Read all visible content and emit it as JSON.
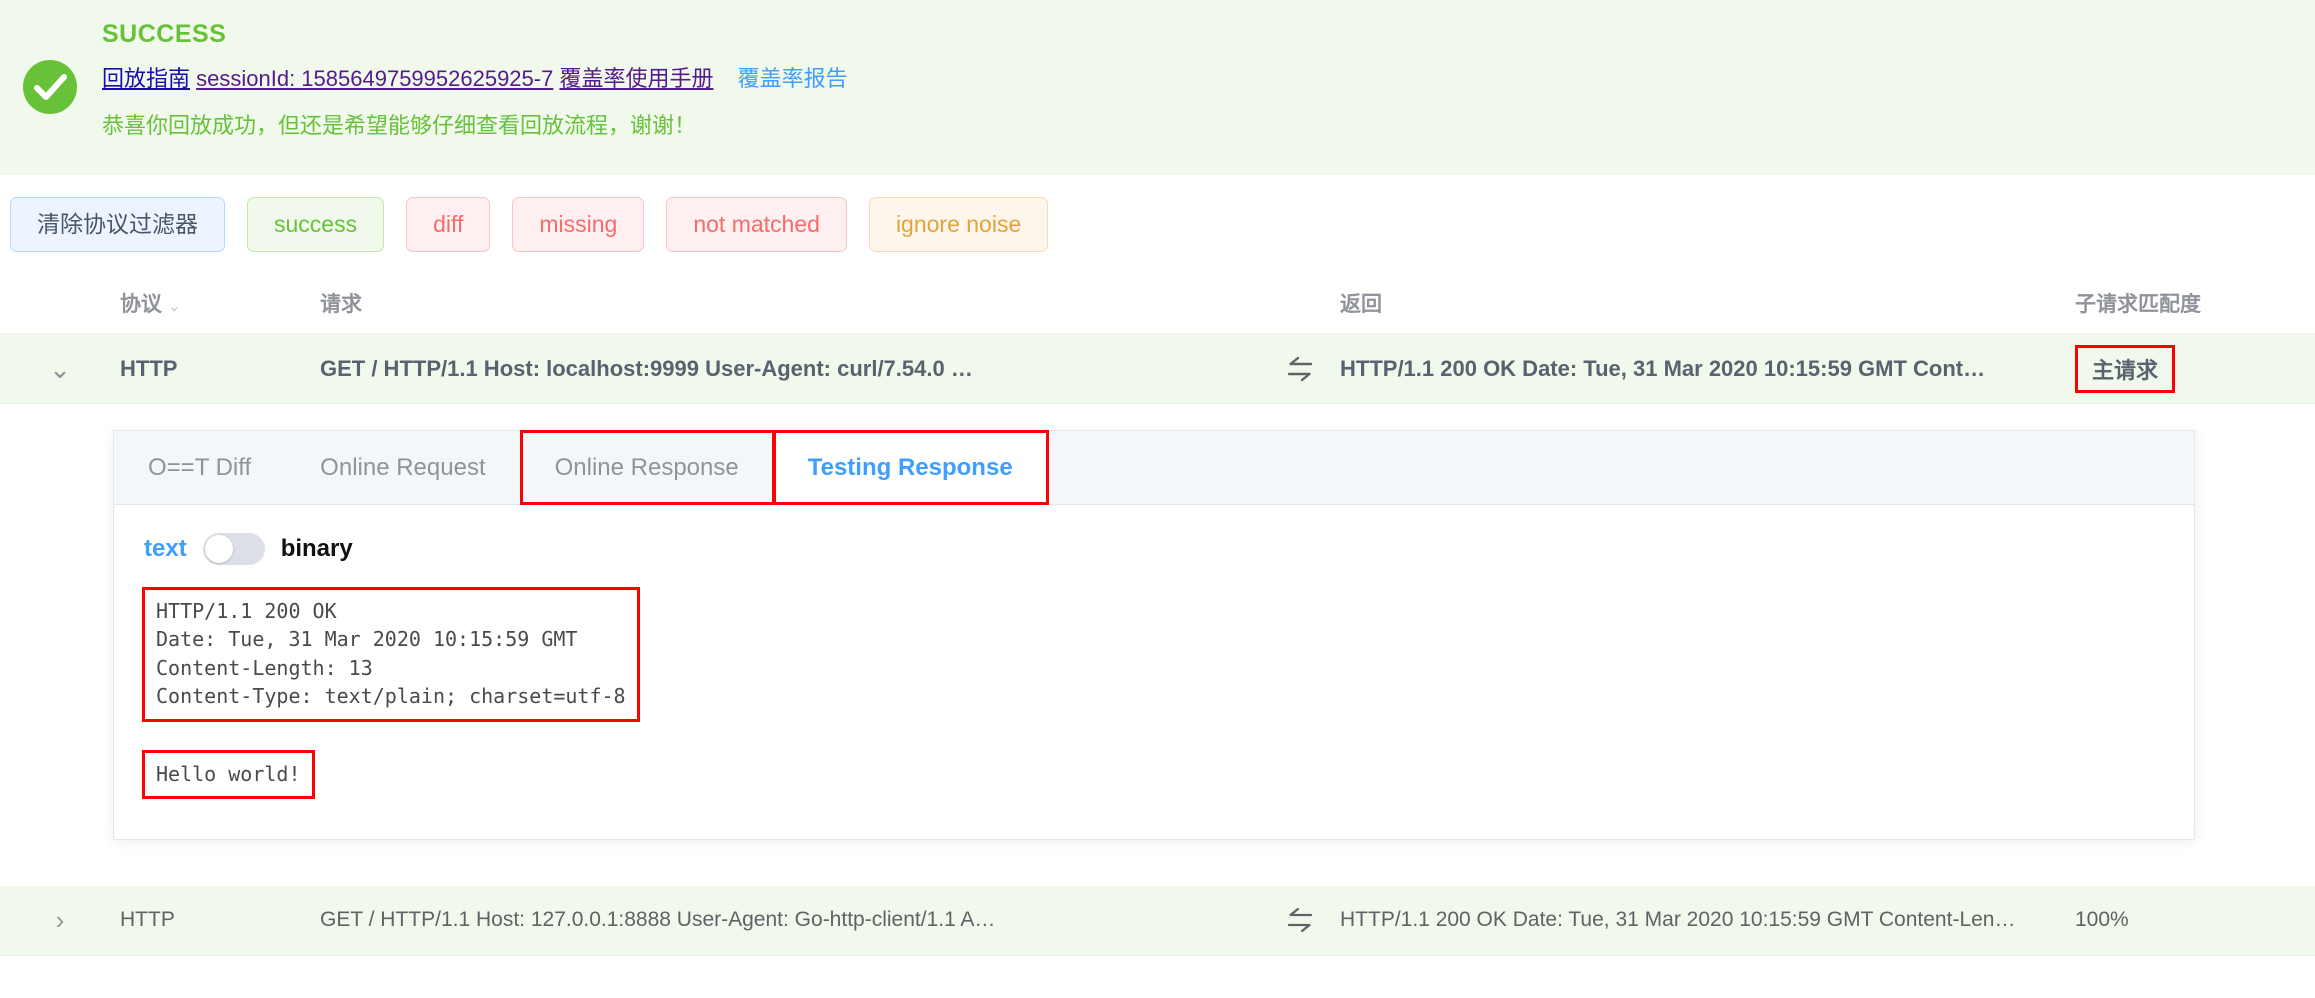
{
  "banner": {
    "status_title": "SUCCESS",
    "icon": "check-circle-icon",
    "accent_color": "#67c23a",
    "background_color": "#f0f9eb",
    "links": {
      "guide": "回放指南",
      "session": "sessionId: 1585649759952625925-7",
      "coverage_manual": "覆盖率使用手册",
      "coverage_report": "覆盖率报告"
    },
    "message": "恭喜你回放成功，但还是希望能够仔细查看回放流程，谢谢！"
  },
  "filters": [
    {
      "label": "清除协议过滤器",
      "style": "clear"
    },
    {
      "label": "success",
      "style": "success"
    },
    {
      "label": "diff",
      "style": "danger"
    },
    {
      "label": "missing",
      "style": "danger"
    },
    {
      "label": "not matched",
      "style": "danger"
    },
    {
      "label": "ignore noise",
      "style": "warn"
    }
  ],
  "table": {
    "columns": {
      "protocol": "协议",
      "request": "请求",
      "response": "返回",
      "match": "子请求匹配度"
    },
    "sort_caret": "⌄",
    "rows": [
      {
        "expanded": true,
        "chevron": "⌄",
        "protocol": "HTTP",
        "request": "GET / HTTP/1.1 Host: localhost:9999 User-Agent: curl/7.54.0 …",
        "swap_icon": "swap-arrows-icon",
        "response": "HTTP/1.1 200 OK Date: Tue, 31 Mar 2020 10:15:59 GMT Cont…",
        "match": "主请求",
        "match_highlighted": true
      },
      {
        "expanded": false,
        "chevron": "›",
        "protocol": "HTTP",
        "request": "GET / HTTP/1.1 Host: 127.0.0.1:8888 User-Agent: Go-http-client/1.1 A…",
        "swap_icon": "swap-arrows-icon",
        "response": "HTTP/1.1 200 OK Date: Tue, 31 Mar 2020 10:15:59 GMT Content-Len…",
        "match": "100%",
        "match_highlighted": false
      }
    ]
  },
  "detail": {
    "tabs": [
      {
        "label": "O==T Diff",
        "active": false,
        "highlighted": false
      },
      {
        "label": "Online Request",
        "active": false,
        "highlighted": false
      },
      {
        "label": "Online Response",
        "active": false,
        "highlighted": true
      },
      {
        "label": "Testing Response",
        "active": true,
        "highlighted": true
      }
    ],
    "toggle": {
      "left_label": "text",
      "right_label": "binary",
      "state": "text"
    },
    "response_headers": "HTTP/1.1 200 OK\nDate: Tue, 31 Mar 2020 10:15:59 GMT\nContent-Length: 13\nContent-Type: text/plain; charset=utf-8",
    "response_body": "Hello world!"
  },
  "colors": {
    "success": "#67c23a",
    "highlight_red": "#ff0000",
    "link_blue": "#1a0dab",
    "link_visited": "#551a8b",
    "tab_active": "#409eff"
  }
}
